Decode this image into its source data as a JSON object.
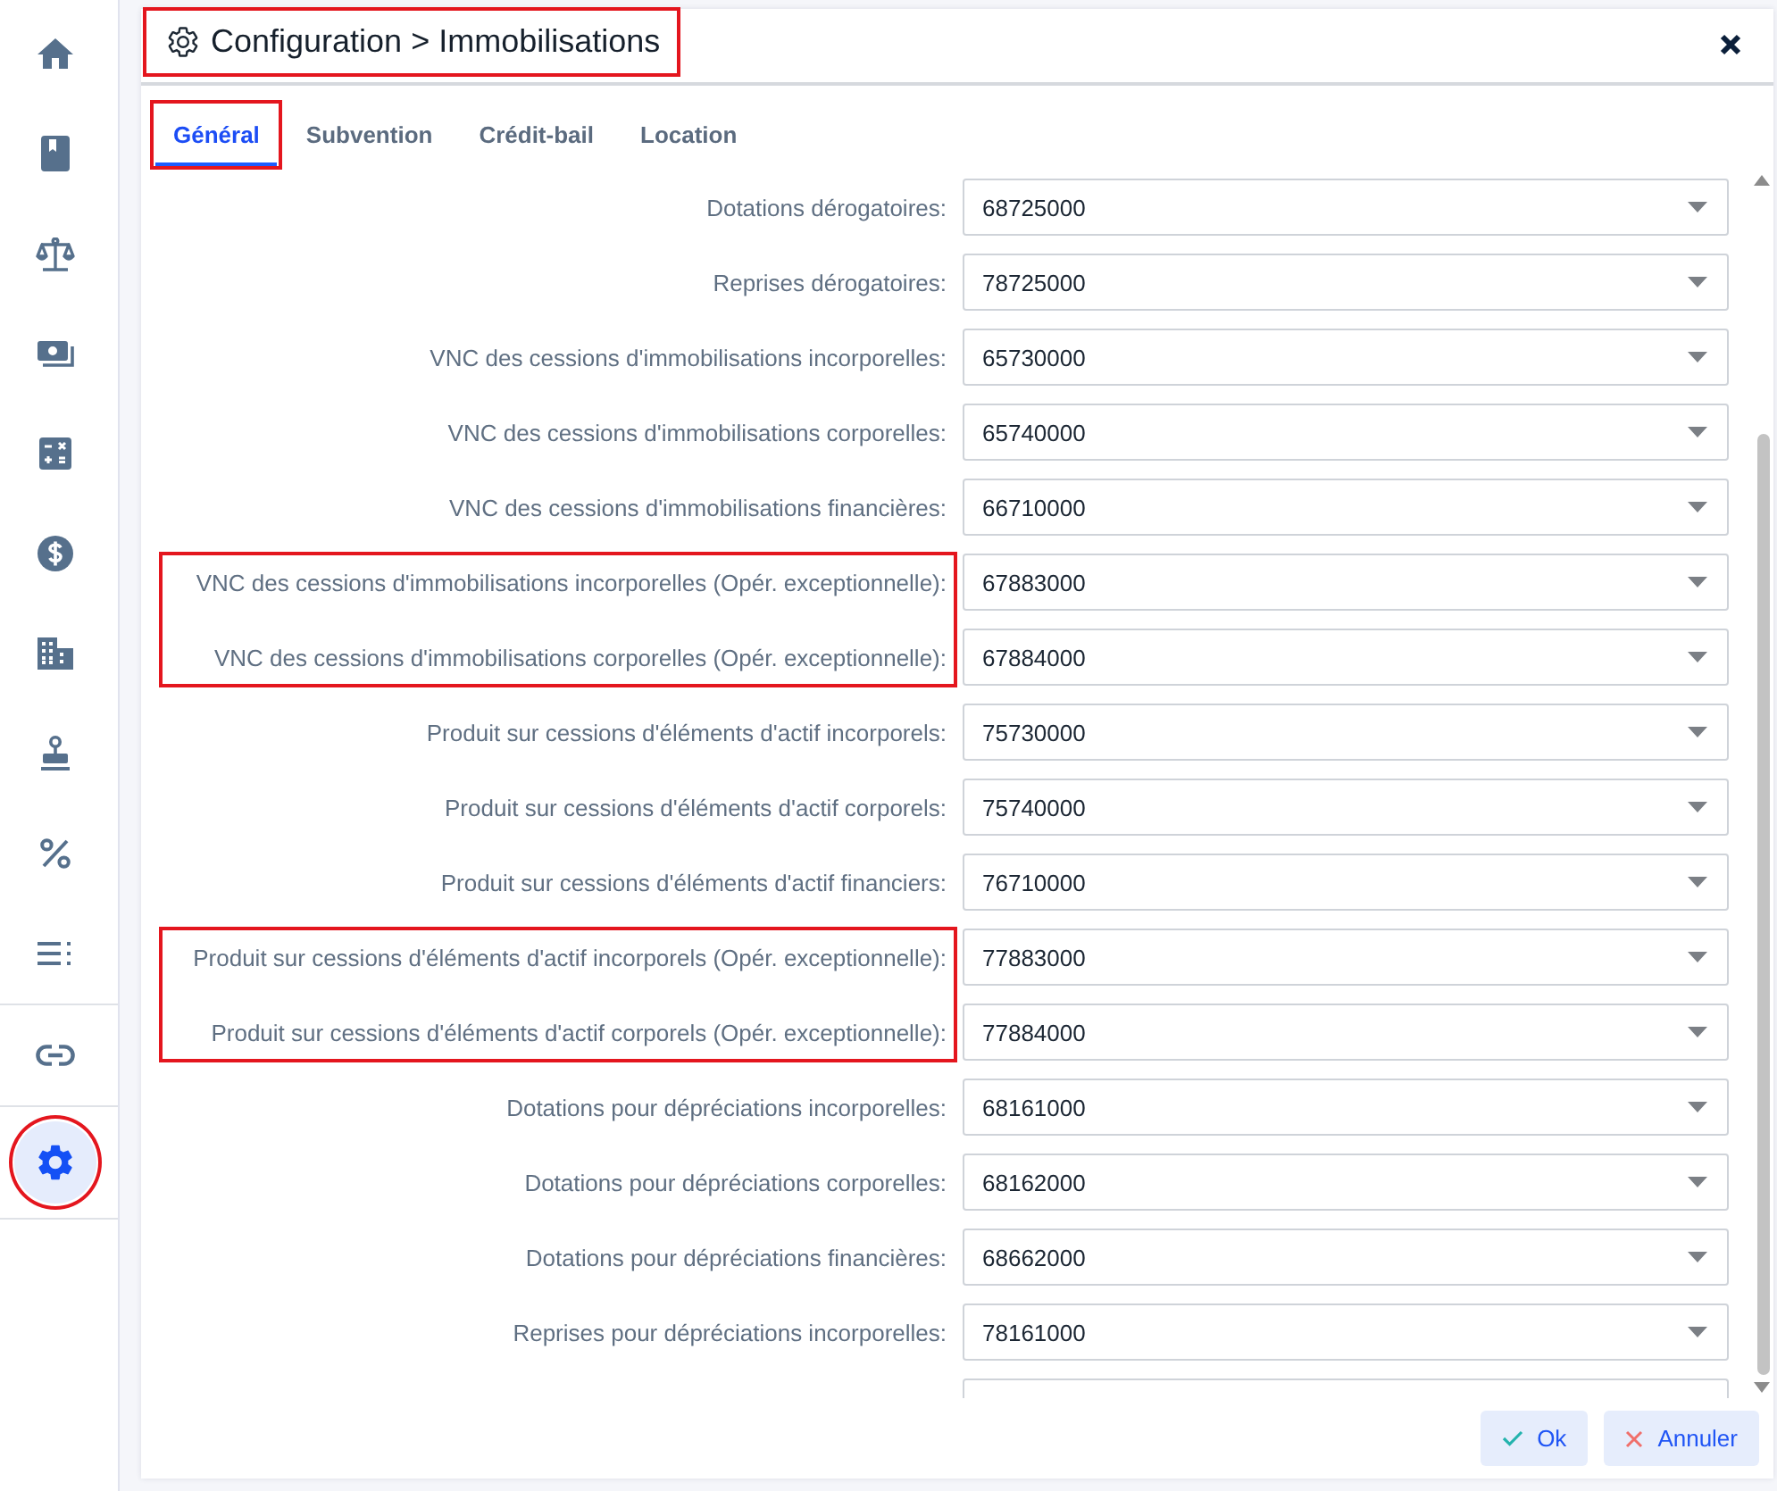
{
  "sidebar": {
    "groups": [
      {
        "items": [
          {
            "selected": false,
            "annotated": false
          },
          {
            "selected": false,
            "annotated": false
          },
          {
            "selected": false,
            "annotated": false
          },
          {
            "selected": false,
            "annotated": false
          },
          {
            "selected": false,
            "annotated": false
          },
          {
            "selected": false,
            "annotated": false
          },
          {
            "selected": false,
            "annotated": false
          },
          {
            "selected": false,
            "annotated": false
          },
          {
            "selected": false,
            "annotated": false
          },
          {
            "selected": false,
            "annotated": false
          }
        ]
      },
      {
        "items": [
          {
            "selected": false,
            "annotated": false
          }
        ]
      },
      {
        "items": [
          {
            "selected": true,
            "annotated": true
          }
        ]
      }
    ]
  },
  "dialog": {
    "title": {
      "text": "Configuration > Immobilisations",
      "annotated": true
    },
    "tabs": [
      {
        "label": "Général",
        "selected": true,
        "annotated": true
      },
      {
        "label": "Subvention",
        "selected": false,
        "annotated": false
      },
      {
        "label": "Crédit-bail",
        "selected": false,
        "annotated": false
      },
      {
        "label": "Location",
        "selected": false,
        "annotated": false
      }
    ],
    "field_groups": [
      {
        "annotated": false,
        "fields": [
          {
            "kind": "select",
            "label": "Dotations dérogatoires:",
            "value": "68725000"
          },
          {
            "kind": "select",
            "label": "Reprises dérogatoires:",
            "value": "78725000"
          },
          {
            "kind": "select",
            "label": "VNC des cessions d'immobilisations incorporelles:",
            "value": "65730000"
          },
          {
            "kind": "select",
            "label": "VNC des cessions d'immobilisations corporelles:",
            "value": "65740000"
          },
          {
            "kind": "select",
            "label": "VNC des cessions d'immobilisations financières:",
            "value": "66710000"
          }
        ]
      },
      {
        "annotated": true,
        "fields": [
          {
            "kind": "select",
            "label": "VNC des cessions d'immobilisations incorporelles (Opér. exceptionnelle):",
            "value": "67883000"
          },
          {
            "kind": "select",
            "label": "VNC des cessions d'immobilisations corporelles (Opér. exceptionnelle):",
            "value": "67884000"
          }
        ]
      },
      {
        "annotated": false,
        "fields": [
          {
            "kind": "select",
            "label": "Produit sur cessions d'éléments d'actif incorporels:",
            "value": "75730000"
          },
          {
            "kind": "select",
            "label": "Produit sur cessions d'éléments d'actif corporels:",
            "value": "75740000"
          },
          {
            "kind": "select",
            "label": "Produit sur cessions d'éléments d'actif financiers:",
            "value": "76710000"
          }
        ]
      },
      {
        "annotated": true,
        "fields": [
          {
            "kind": "select",
            "label": "Produit sur cessions d'éléments d'actif incorporels (Opér. exceptionnelle):",
            "value": "77883000"
          },
          {
            "kind": "select",
            "label": "Produit sur cessions d'éléments d'actif corporels (Opér. exceptionnelle):",
            "value": "77884000"
          }
        ]
      },
      {
        "annotated": false,
        "fields": [
          {
            "kind": "select",
            "label": "Dotations pour dépréciations incorporelles:",
            "value": "68161000"
          },
          {
            "kind": "select",
            "label": "Dotations pour dépréciations corporelles:",
            "value": "68162000"
          },
          {
            "kind": "select",
            "label": "Dotations pour dépréciations financières:",
            "value": "68662000"
          },
          {
            "kind": "select",
            "label": "Reprises pour dépréciations incorporelles:",
            "value": "78161000"
          },
          {
            "kind": "partial"
          }
        ]
      }
    ],
    "buttons": [
      {
        "kind": "confirm",
        "label": "Ok"
      },
      {
        "kind": "cancel",
        "label": "Annuler"
      }
    ]
  }
}
